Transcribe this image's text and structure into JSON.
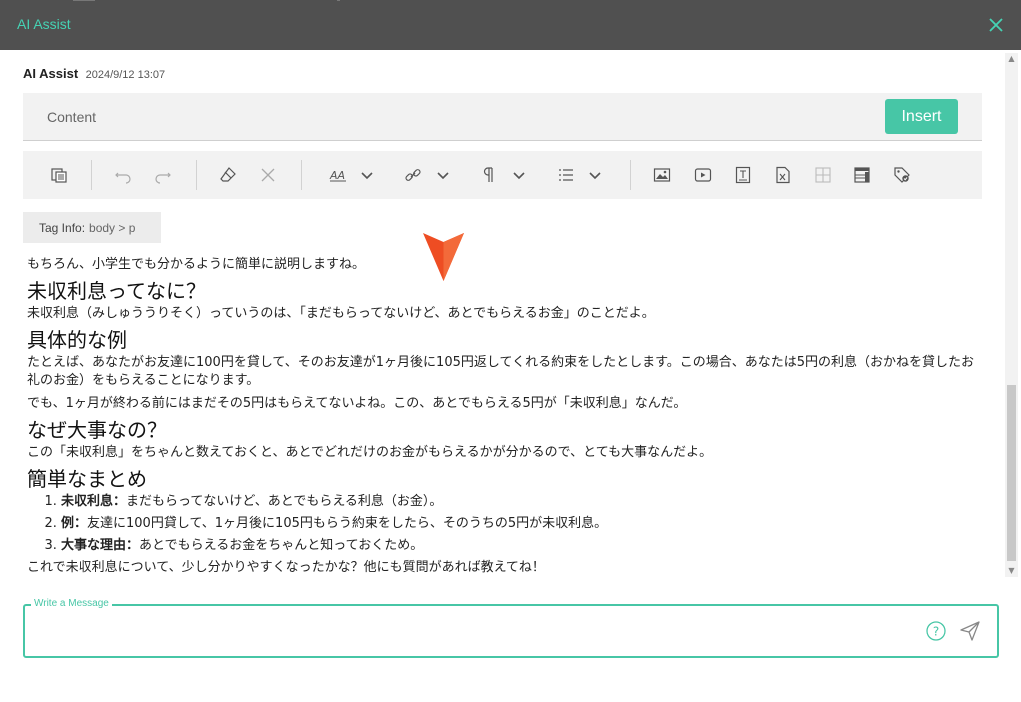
{
  "window": {
    "title": "AI Assist",
    "close_icon": "close-icon",
    "accent": "#45d3b4",
    "titlebar_color": "#505050"
  },
  "message": {
    "author": "AI Assist",
    "timestamp": "2024/9/12 13:07"
  },
  "content_header": {
    "label": "Content",
    "insert_label": "Insert",
    "insert_color": "#47c6a6"
  },
  "toolbar": {
    "icons": [
      "select-all-icon",
      "undo-icon",
      "redo-icon",
      "eraser-icon",
      "clear-icon",
      "font-size-icon",
      "chevron-down-icon",
      "link-icon",
      "chevron-down-icon",
      "paragraph-icon",
      "chevron-down-icon",
      "list-icon",
      "chevron-down-icon",
      "image-icon",
      "video-icon",
      "text-box-icon",
      "file-icon",
      "table-icon",
      "template-icon",
      "tag-icon"
    ]
  },
  "tag_info": {
    "label": "Tag Info:",
    "path": "body  >  p"
  },
  "doc": {
    "intro": "もちろん、小学生でも分かるように簡単に説明しますね。",
    "h1": "未収利息ってなに？",
    "p1": "未収利息（みしゅううりそく）っていうのは、「まだもらってないけど、あとでもらえるお金」のことだよ。",
    "h2": "具体的な例",
    "p2": "たとえば、あなたがお友達に100円を貸して、そのお友達が1ヶ月後に105円返してくれる約束をしたとします。この場合、あなたは5円の利息（おかねを貸したお礼のお金）をもらえることになります。",
    "p3": "でも、1ヶ月が終わる前にはまだその5円はもらえてないよね。この、あとでもらえる5円が「未収利息」なんだ。",
    "h3": "なぜ大事なの？",
    "p4": "この「未収利息」をちゃんと数えておくと、あとでどれだけのお金がもらえるかが分かるので、とても大事なんだよ。",
    "h4": "簡単なまとめ",
    "list": [
      {
        "term": "未収利息：",
        "text": "まだもらってないけど、あとでもらえる利息（お金）。"
      },
      {
        "term": "例：",
        "text": "友達に100円貸して、1ヶ月後に105円もらう約束をしたら、そのうちの5円が未収利息。"
      },
      {
        "term": "大事な理由：",
        "text": "あとでもらえるお金をちゃんと知っておくため。"
      }
    ],
    "outro": "これで未収利息について、少し分かりやすくなったかな？他にも質問があれば教えてね！"
  },
  "composer": {
    "label": "Write a Message",
    "value": "",
    "help_icon": "help-circle-icon",
    "send_icon": "send-icon"
  }
}
